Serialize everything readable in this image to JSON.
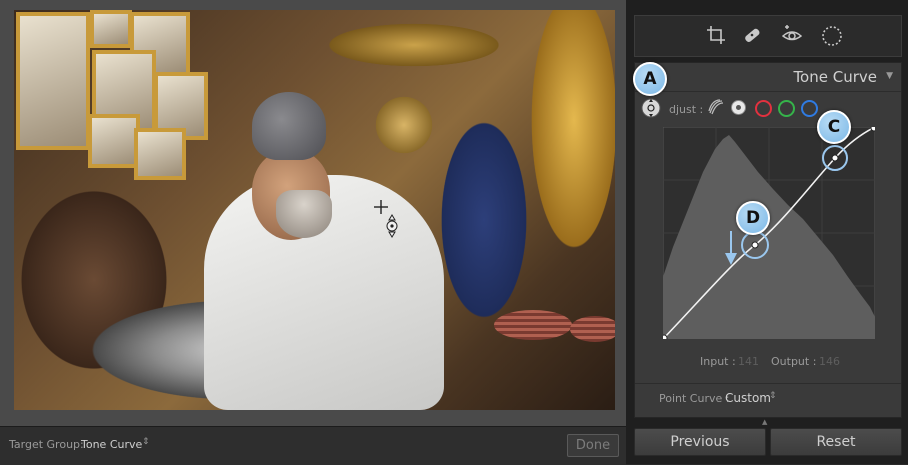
{
  "left_bar": {
    "target_group_label": "Target Group:",
    "target_group_value": "Tone Curve",
    "target_group_arrows": "⇕",
    "done_label": "Done"
  },
  "tool_strip": {
    "icons": [
      "crop-icon",
      "healing-brush-icon",
      "red-eye-icon",
      "radial-filter-icon"
    ]
  },
  "tone_curve": {
    "title": "Tone Curve",
    "collapse_glyph": "▼",
    "adjust_label": "djust :",
    "channels": [
      "point-curve",
      "rgb",
      "red",
      "green",
      "blue"
    ],
    "channel_colors": {
      "red": "#e2313f",
      "green": "#35b34a",
      "blue": "#2f7be2",
      "rgb": "#e8e8e8"
    },
    "input_label": "Input :",
    "input_value": "141",
    "output_label": "Output :",
    "output_value": "146",
    "point_curve_label": "Point Curve :",
    "point_curve_value": "Custom",
    "point_curve_arrows": "⇕"
  },
  "footer": {
    "previous_label": "Previous",
    "reset_label": "Reset"
  },
  "callouts": {
    "a": "A",
    "c": "C",
    "d": "D"
  }
}
